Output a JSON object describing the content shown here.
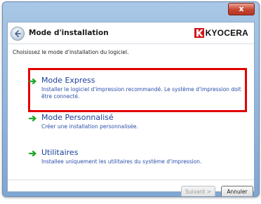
{
  "window": {
    "close_label": "x",
    "title": "Mode d'installation",
    "brand": "KYOCERA"
  },
  "instruction": "Choisissez le mode d'installation du logiciel.",
  "options": [
    {
      "title": "Mode Express",
      "description": "Installer le logiciel d'impression recommandé. Le système d'impression doit être connecté."
    },
    {
      "title": "Mode Personnalisé",
      "description": "Créer une installation personnalisée."
    },
    {
      "title": "Utilitaires",
      "description": "Installee uniquement les utilitaires du système d'impression."
    }
  ],
  "buttons": {
    "next": "Suivant >",
    "cancel": "Annuler"
  },
  "colors": {
    "highlight": "#e00000",
    "option_text": "#1a3f9a",
    "arrow": "#1faa2a"
  },
  "icons": {
    "back": "back-arrow-icon",
    "option": "green-arrow-icon",
    "logo": "kyocera-logo-icon"
  }
}
